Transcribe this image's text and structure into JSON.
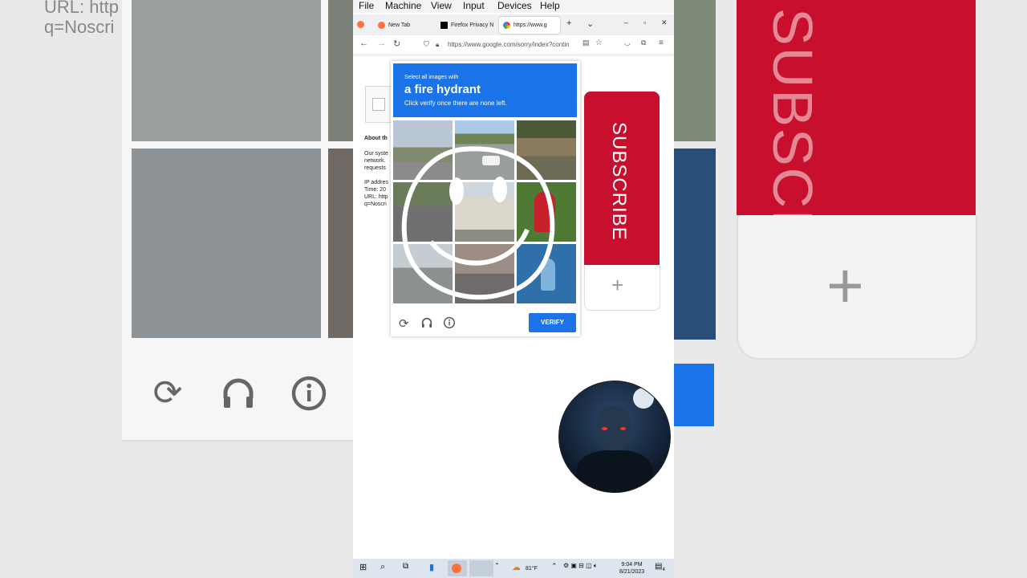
{
  "background": {
    "url_text": "URL: http\nq=Noscri",
    "subscribe_text": "SUBSCRIBE",
    "plus_text": "+"
  },
  "menubar": {
    "items": [
      "File",
      "Machine",
      "View",
      "Input",
      "Devices",
      "Help"
    ]
  },
  "browser": {
    "tabs": [
      {
        "label": "New Tab",
        "icon": "firefox-icon"
      },
      {
        "label": "Firefox Privacy N",
        "icon": "mozilla-icon"
      },
      {
        "label": "https://www.g",
        "icon": "google-icon"
      }
    ],
    "new_tab": "+",
    "tab_list": "⌄",
    "window_controls": {
      "minimize": "–",
      "maximize": "▫",
      "close": "✕"
    },
    "url": "https://www.google.com/sorry/index?contin"
  },
  "page": {
    "about_heading": "About th",
    "body_lines": [
      "Our syste",
      "network.",
      "requests"
    ],
    "info_lines": [
      "IP addres",
      "Time: 20",
      "URL: http",
      "q=Noscri"
    ]
  },
  "captcha": {
    "instruction_small": "Select all images with",
    "target": "a fire hydrant",
    "instruction_sub": "Click verify once there are none left.",
    "verify_label": "VERIFY",
    "icons": [
      "reload-icon",
      "headphones-icon",
      "info-icon"
    ]
  },
  "overlay": {
    "subscribe_label": "SUBSCRIBE",
    "plus_label": "+"
  },
  "taskbar": {
    "weather": "81°F",
    "time": "9:04 PM",
    "date": "8/21/2023",
    "notification_count": "4"
  },
  "colors": {
    "captcha_blue": "#1a73e8",
    "subscribe_red": "#c8102e"
  }
}
